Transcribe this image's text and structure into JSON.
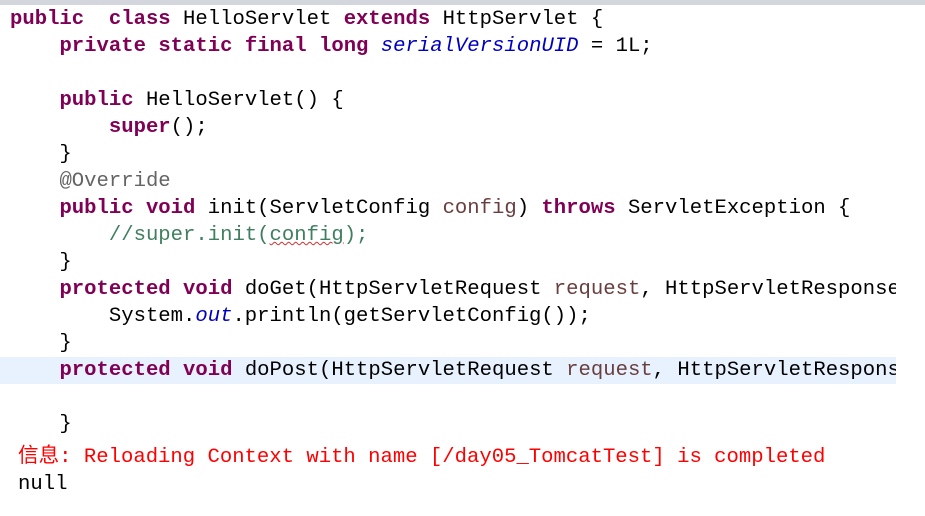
{
  "colors": {
    "keyword": "#7f0055",
    "parameter": "#6a3e3e",
    "field": "#0000c0",
    "annotation": "#646464",
    "comment": "#3f7f5f",
    "console_info": "#ff0000",
    "current_line": "#e8f2fe"
  },
  "editor": {
    "lines": [
      [
        [
          "kw",
          "public"
        ],
        [
          "",
          "  "
        ],
        [
          "kw",
          "class"
        ],
        [
          "",
          " HelloServlet "
        ],
        [
          "kw",
          "extends"
        ],
        [
          "",
          " HttpServlet {"
        ]
      ],
      [
        [
          "",
          "    "
        ],
        [
          "kw",
          "private"
        ],
        [
          "",
          " "
        ],
        [
          "kw",
          "static"
        ],
        [
          "",
          " "
        ],
        [
          "kw",
          "final"
        ],
        [
          "",
          " "
        ],
        [
          "kw",
          "long"
        ],
        [
          "",
          " "
        ],
        [
          "field",
          "serialVersionUID"
        ],
        [
          "",
          " = 1L;"
        ]
      ],
      [],
      [
        [
          "",
          "    "
        ],
        [
          "kw",
          "public"
        ],
        [
          "",
          " HelloServlet() {"
        ]
      ],
      [
        [
          "",
          "        "
        ],
        [
          "kw",
          "super"
        ],
        [
          "",
          "();"
        ]
      ],
      [
        [
          "",
          "    }"
        ]
      ],
      [
        [
          "",
          "    "
        ],
        [
          "annot",
          "@Override"
        ]
      ],
      [
        [
          "",
          "    "
        ],
        [
          "kw",
          "public"
        ],
        [
          "",
          " "
        ],
        [
          "kw",
          "void"
        ],
        [
          "",
          " init(ServletConfig "
        ],
        [
          "param",
          "config"
        ],
        [
          "",
          ") "
        ],
        [
          "kw",
          "throws"
        ],
        [
          "",
          " ServletException {"
        ]
      ],
      [
        [
          "",
          "        "
        ],
        [
          "comment",
          "//super.init("
        ],
        [
          "comment squig",
          "config"
        ],
        [
          "comment",
          ");"
        ]
      ],
      [
        [
          "",
          "    }"
        ]
      ],
      [
        [
          "",
          "    "
        ],
        [
          "kw",
          "protected"
        ],
        [
          "",
          " "
        ],
        [
          "kw",
          "void"
        ],
        [
          "",
          " doGet(HttpServletRequest "
        ],
        [
          "param",
          "request"
        ],
        [
          "",
          ", HttpServletResponse response)"
        ]
      ],
      [
        [
          "",
          "        System."
        ],
        [
          "field",
          "out"
        ],
        [
          "",
          ".println(getServletConfig());"
        ]
      ],
      [
        [
          "",
          "    }"
        ]
      ],
      [
        [
          "",
          "    "
        ],
        [
          "kw",
          "protected"
        ],
        [
          "",
          " "
        ],
        [
          "kw",
          "void"
        ],
        [
          "",
          " doPost(HttpServletRequest "
        ],
        [
          "param",
          "request"
        ],
        [
          "",
          ", HttpServletResponse response)"
        ]
      ],
      [],
      [
        [
          "",
          "    }"
        ]
      ]
    ],
    "highlighted_line": 13
  },
  "console": {
    "info_line": "信息: Reloading Context with name [/day05_TomcatTest] is completed",
    "output_line": "null"
  }
}
